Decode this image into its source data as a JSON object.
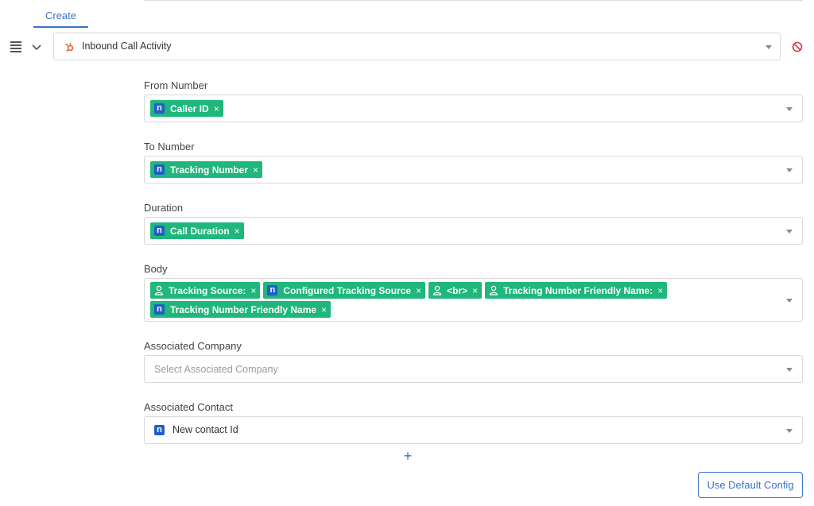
{
  "tabs": {
    "create_label": "Create"
  },
  "activity": {
    "selected": "Inbound Call Activity"
  },
  "fields": {
    "from_number": {
      "label": "From Number",
      "chips": [
        {
          "kind": "n",
          "text": "Caller ID"
        }
      ]
    },
    "to_number": {
      "label": "To Number",
      "chips": [
        {
          "kind": "n",
          "text": "Tracking Number"
        }
      ]
    },
    "duration": {
      "label": "Duration",
      "chips": [
        {
          "kind": "n",
          "text": "Call Duration"
        }
      ]
    },
    "body": {
      "label": "Body",
      "chips": [
        {
          "kind": "person",
          "text": "Tracking Source:"
        },
        {
          "kind": "n",
          "text": "Configured Tracking Source"
        },
        {
          "kind": "person",
          "text": "<br>"
        },
        {
          "kind": "person",
          "text": "Tracking Number Friendly Name:"
        },
        {
          "kind": "n",
          "text": "Tracking Number Friendly Name"
        }
      ]
    },
    "associated_company": {
      "label": "Associated Company",
      "placeholder": "Select Associated Company"
    },
    "associated_contact": {
      "label": "Associated Contact",
      "value": "New contact Id"
    }
  },
  "icons": {
    "chip_n_glyph": "n",
    "plus_glyph": "+",
    "chip_remove_glyph": "×"
  },
  "buttons": {
    "use_default_config": "Use Default Config"
  },
  "colors": {
    "accent": "#3b74c9",
    "chip": "#1fb77b",
    "n_icon": "#1f5fcc",
    "danger": "#d9363e"
  }
}
